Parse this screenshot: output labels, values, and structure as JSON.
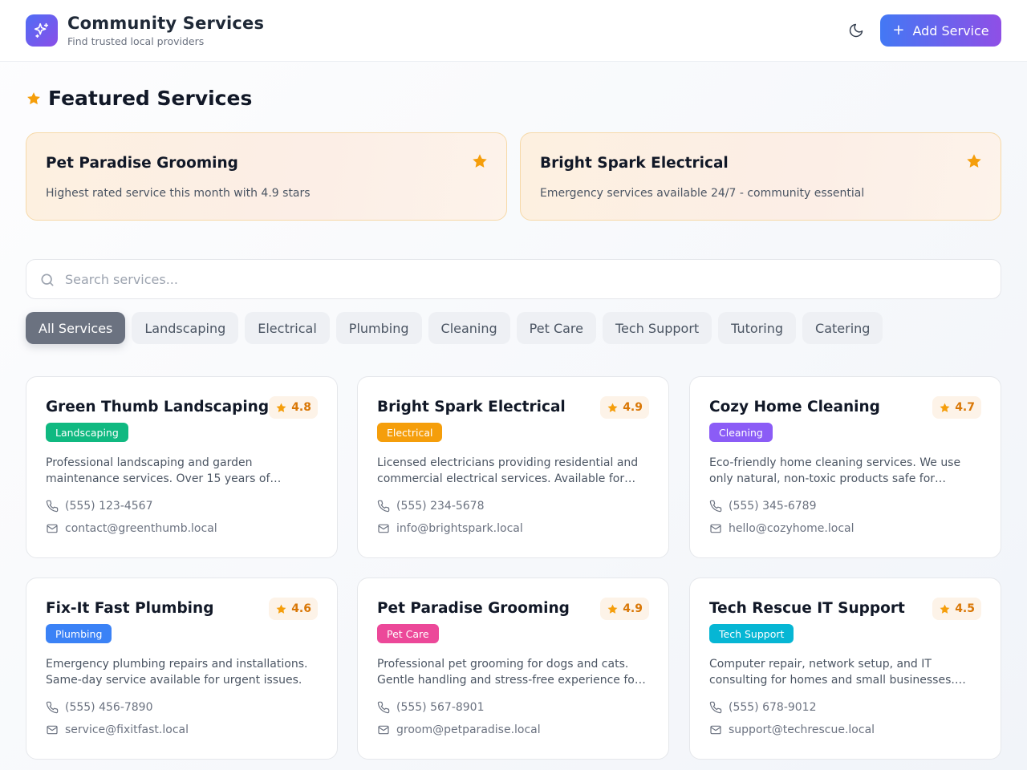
{
  "header": {
    "title": "Community Services",
    "subtitle": "Find trusted local providers",
    "logo_icon": "sparkles-icon",
    "theme_icon": "moon-icon",
    "add_button": {
      "plus": "+",
      "label": "Add Service"
    }
  },
  "featured": {
    "heading": "Featured Services",
    "cards": [
      {
        "name": "Pet Paradise Grooming",
        "desc": "Highest rated service this month with 4.9 stars"
      },
      {
        "name": "Bright Spark Electrical",
        "desc": "Emergency services available 24/7 - community essential"
      }
    ]
  },
  "search": {
    "placeholder": "Search services...",
    "value": ""
  },
  "filters": [
    {
      "label": "All Services",
      "active": true
    },
    {
      "label": "Landscaping"
    },
    {
      "label": "Electrical"
    },
    {
      "label": "Plumbing"
    },
    {
      "label": "Cleaning"
    },
    {
      "label": "Pet Care"
    },
    {
      "label": "Tech Support"
    },
    {
      "label": "Tutoring"
    },
    {
      "label": "Catering"
    }
  ],
  "services": [
    {
      "name": "Green Thumb Landscaping",
      "rating": "4.8",
      "category": "Landscaping",
      "category_color": "#10b981",
      "desc": "Professional landscaping and garden maintenance services. Over 15 years of experience in residential and commercial projects.",
      "phone": "(555) 123-4567",
      "email": "contact@greenthumb.local"
    },
    {
      "name": "Bright Spark Electrical",
      "rating": "4.9",
      "category": "Electrical",
      "category_color": "#f59e0b",
      "desc": "Licensed electricians providing residential and commercial electrical services. Available for emergency calls 24/7.",
      "phone": "(555) 234-5678",
      "email": "info@brightspark.local"
    },
    {
      "name": "Cozy Home Cleaning",
      "rating": "4.7",
      "category": "Cleaning",
      "category_color": "#8b5cf6",
      "desc": "Eco-friendly home cleaning services. We use only natural, non-toxic products safe for children and pets.",
      "phone": "(555) 345-6789",
      "email": "hello@cozyhome.local"
    },
    {
      "name": "Fix-It Fast Plumbing",
      "rating": "4.6",
      "category": "Plumbing",
      "category_color": "#3b82f6",
      "desc": "Emergency plumbing repairs and installations. Same-day service available for urgent issues.",
      "phone": "(555) 456-7890",
      "email": "service@fixitfast.local"
    },
    {
      "name": "Pet Paradise Grooming",
      "rating": "4.9",
      "category": "Pet Care",
      "category_color": "#ec4899",
      "desc": "Professional pet grooming for dogs and cats. Gentle handling and stress-free experience for your furry friends.",
      "phone": "(555) 567-8901",
      "email": "groom@petparadise.local"
    },
    {
      "name": "Tech Rescue IT Support",
      "rating": "4.5",
      "category": "Tech Support",
      "category_color": "#06b6d4",
      "desc": "Computer repair, network setup, and IT consulting for homes and small businesses. Remote support available.",
      "phone": "(555) 678-9012",
      "email": "support@techrescue.local"
    }
  ],
  "colors": {
    "brand_start": "#4378f4",
    "brand_end": "#8f4fe6",
    "star": "#f59e0b",
    "rating_text": "#d97706"
  }
}
